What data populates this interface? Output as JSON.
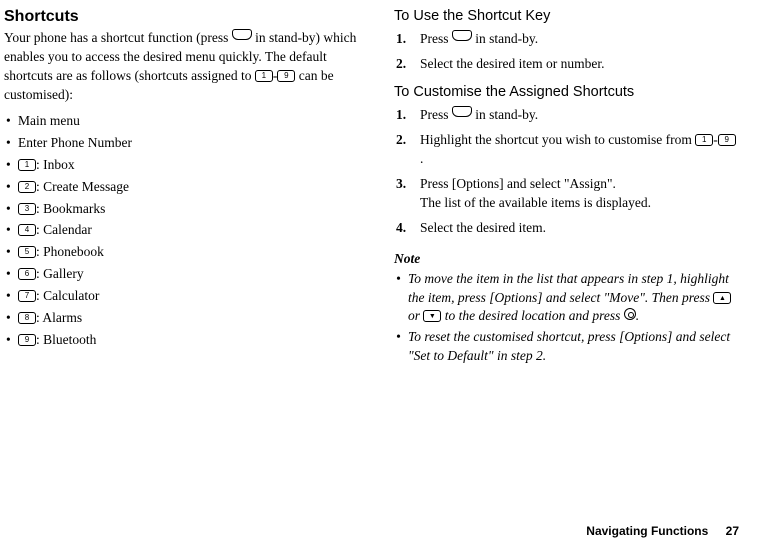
{
  "left": {
    "heading": "Shortcuts",
    "intro_before_key": "Your phone has a shortcut function (press ",
    "intro_after_key": " in stand-by) which enables you to access the desired menu quickly. The default shortcuts are as follows (shortcuts assigned to ",
    "intro_after_range": " can be customised):",
    "range_dash": "-",
    "items": [
      {
        "key": "",
        "label": "Main menu"
      },
      {
        "key": "",
        "label": "Enter Phone Number"
      },
      {
        "key": "1",
        "label": ": Inbox"
      },
      {
        "key": "2",
        "label": ": Create Message"
      },
      {
        "key": "3",
        "label": ": Bookmarks"
      },
      {
        "key": "4",
        "label": ": Calendar"
      },
      {
        "key": "5",
        "label": ": Phonebook"
      },
      {
        "key": "6",
        "label": ": Gallery"
      },
      {
        "key": "7",
        "label": ": Calculator"
      },
      {
        "key": "8",
        "label": ": Alarms"
      },
      {
        "key": "9",
        "label": ": Bluetooth"
      }
    ]
  },
  "right": {
    "section1": {
      "heading": "To Use the Shortcut Key",
      "steps": [
        {
          "num": "1.",
          "before": "Press ",
          "after": " in stand-by."
        },
        {
          "num": "2.",
          "text": "Select the desired item or number."
        }
      ]
    },
    "section2": {
      "heading": "To Customise the Assigned Shortcuts",
      "steps": [
        {
          "num": "1.",
          "before": "Press ",
          "after": " in stand-by."
        },
        {
          "num": "2.",
          "before": "Highlight the shortcut you wish to customise from ",
          "range_dash": "-",
          "after": "."
        },
        {
          "num": "3.",
          "line1": "Press [Options] and select \"Assign\".",
          "line2": "The list of the available items is displayed."
        },
        {
          "num": "4.",
          "text": "Select the desired item."
        }
      ]
    },
    "note_head": "Note",
    "notes": [
      {
        "before": "To move the item in the list that appears in step 1, highlight the item, press [Options] and select \"Move\". Then press ",
        "mid": " or ",
        "after": " to the desired location and press ",
        "end": "."
      },
      {
        "text": "To reset the customised shortcut, press [Options] and select \"Set to Default\" in step 2."
      }
    ]
  },
  "footer": {
    "title": "Navigating Functions",
    "page": "27"
  },
  "keys": {
    "shortcut": "⌂",
    "k1": "1",
    "k2": "2",
    "k3": "3",
    "k4": "4",
    "k5": "5",
    "k6": "6",
    "k7": "7",
    "k8": "8",
    "k9": "9"
  }
}
